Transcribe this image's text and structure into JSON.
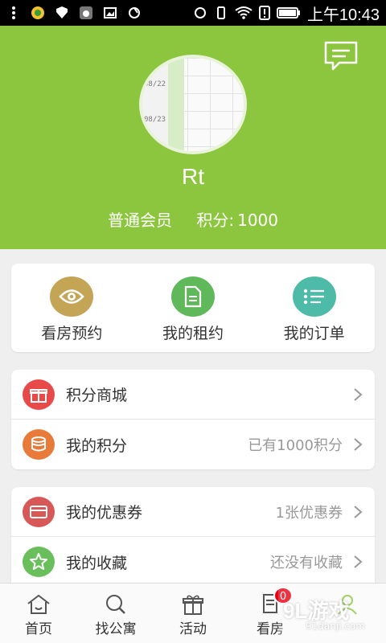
{
  "status_bar": {
    "time": "上午10:43",
    "left_icons": [
      "menu-dots-icon",
      "app-icon",
      "shield-icon",
      "music-icon",
      "image-icon",
      "sync-icon"
    ],
    "right_icons": [
      "alarm-icon",
      "vibrate-icon",
      "wifi-icon",
      "no-sim-icon",
      "battery-icon"
    ]
  },
  "profile": {
    "username": "Rt",
    "member_level": "普通会员",
    "points_label": "积分:",
    "points_value": "1000",
    "avatar_dates": [
      "",
      "08/22",
      "",
      "08/23",
      "",
      "24"
    ],
    "colors": {
      "header_bg": "#8cc63f"
    }
  },
  "quick_actions": [
    {
      "label": "看房预约",
      "icon": "eye-icon",
      "color": "#c4a455"
    },
    {
      "label": "我的租约",
      "icon": "document-icon",
      "color": "#5fb85a"
    },
    {
      "label": "我的订单",
      "icon": "list-icon",
      "color": "#4dbba8"
    }
  ],
  "menu_group_1": [
    {
      "label": "积分商城",
      "value": "",
      "icon": "gift-icon",
      "color": "#e84a4a"
    },
    {
      "label": "我的积分",
      "value": "已有1000积分",
      "icon": "coins-icon",
      "color": "#e87a3a"
    }
  ],
  "menu_group_2": [
    {
      "label": "我的优惠券",
      "value": "1张优惠券",
      "icon": "card-icon",
      "color": "#d85858"
    },
    {
      "label": "我的收藏",
      "value": "还没有收藏",
      "icon": "star-icon",
      "color": "#6abf5c"
    }
  ],
  "tab_bar": [
    {
      "label": "首页",
      "icon": "home-icon"
    },
    {
      "label": "找公寓",
      "icon": "search-icon"
    },
    {
      "label": "活动",
      "icon": "gift-icon"
    },
    {
      "label": "看房",
      "icon": "document-icon",
      "badge": "0"
    },
    {
      "label": "",
      "icon": "profile-icon"
    }
  ],
  "watermark": {
    "main": "9L游戏",
    "sub": "91danji.com"
  }
}
